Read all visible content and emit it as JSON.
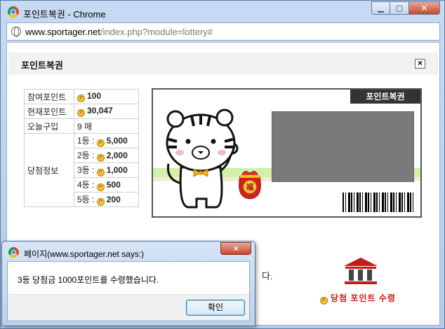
{
  "window": {
    "title": "포인트복권 - Chrome",
    "url_host": "www.sportager.net",
    "url_path": "/index.php?module=lottery#"
  },
  "popup": {
    "title": "포인트복권",
    "close_label": "×"
  },
  "info_table": {
    "rows": [
      {
        "label": "참여포인트",
        "value": "100"
      },
      {
        "label": "현재포인트",
        "value": "30,047"
      },
      {
        "label": "오늘구입",
        "value": "9 매"
      }
    ],
    "prize_label": "당첨정보",
    "prizes": [
      {
        "rank": "1등 :",
        "value": "5,000"
      },
      {
        "rank": "2등 :",
        "value": "2,000"
      },
      {
        "rank": "3등 :",
        "value": "1,000"
      },
      {
        "rank": "4등 :",
        "value": "500"
      },
      {
        "rank": "5등 :",
        "value": "200"
      }
    ]
  },
  "card": {
    "tag": "포인트복권",
    "bag_char": "福"
  },
  "receive": {
    "label": "당첨 포인트 수령"
  },
  "behind_text": "다.",
  "alert": {
    "title": "페이지(www.sportager.net says:)",
    "message": "3등 당첨금 1000포인트를 수령했습니다.",
    "ok_label": "확인",
    "close_label": "×"
  },
  "colors": {
    "accent_red": "#d01414",
    "coin": "#e9a800",
    "card_tag_bg": "#333333"
  }
}
